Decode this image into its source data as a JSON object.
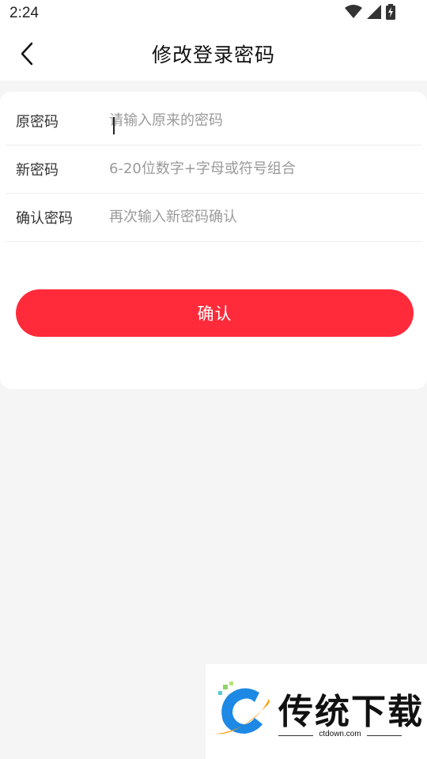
{
  "status_bar": {
    "time": "2:24",
    "icons": [
      "wifi-icon",
      "cell-signal-icon",
      "battery-charging-icon"
    ]
  },
  "header": {
    "title": "修改登录密码",
    "back_icon": "chevron-left-icon"
  },
  "form": {
    "fields": [
      {
        "label": "原密码",
        "value": "",
        "placeholder": "请输入原来的密码"
      },
      {
        "label": "新密码",
        "value": "",
        "placeholder": "6-20位数字+字母或符号组合"
      },
      {
        "label": "确认密码",
        "value": "",
        "placeholder": "再次输入新密码确认"
      }
    ],
    "submit_label": "确认"
  },
  "watermark": {
    "brand": "传统下载",
    "url": "ctdown.com"
  },
  "colors": {
    "accent": "#ff2b3a",
    "background": "#f5f5f5",
    "card": "#ffffff"
  }
}
